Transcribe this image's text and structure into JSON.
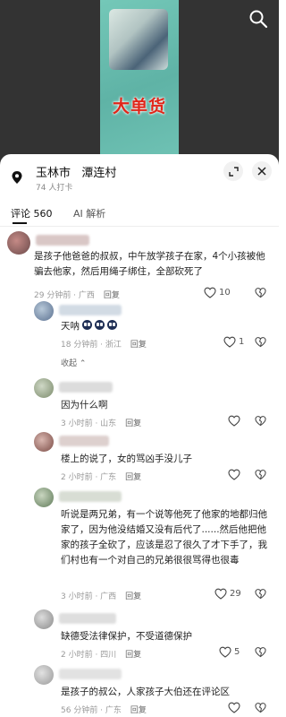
{
  "video": {
    "caption": "大单货"
  },
  "location": {
    "name": "玉林市   潭连村",
    "checkins": "74 人打卡"
  },
  "tabs": [
    {
      "label": "评论 560"
    },
    {
      "label": "AI 解析"
    }
  ],
  "comments": [
    {
      "text": "是孩子他爸爸的叔叔，中午放学孩子在家，4个小孩被他骗去他家，然后用绳子绑住，全部砍死了",
      "time": "29 分钟前 · 广西",
      "reply": "回复",
      "likes": "10"
    },
    {
      "text": "天呐",
      "time": "18 分钟前 · 浙江",
      "reply": "回复",
      "likes": "1",
      "collapse": "收起"
    },
    {
      "text": "因为什么啊",
      "time": "3 小时前 · 山东",
      "reply": "回复",
      "likes": ""
    },
    {
      "text": "楼上的说了，女的骂凶手没儿子",
      "time": "2 小时前 · 广东",
      "reply": "回复",
      "likes": ""
    },
    {
      "text": "听说是两兄弟，有一个说等他死了他家的地都归他家了，因为他没结婚又没有后代了......然后他把他家的孩子全砍了，应该是忍了很久了才下手了，我们村也有一个对自己的兄弟很很骂得也很毒",
      "time": "3 小时前 · 广西",
      "reply": "回复",
      "likes": "29"
    },
    {
      "text": "缺德受法律保护，不受道德保护",
      "time": "2 小时前 · 四川",
      "reply": "回复",
      "likes": "5"
    },
    {
      "text": "是孩子的叔公，人家孩子大伯还在评论区",
      "time": "56 分钟前 · 广东",
      "reply": "回复",
      "likes": ""
    }
  ],
  "icons": {
    "search": "search-icon",
    "pin": "location-pin-icon",
    "expand": "expand-icon",
    "close": "close-icon",
    "like": "heart-icon",
    "dislike": "broken-heart-icon",
    "emoji": "emoji-icon"
  }
}
